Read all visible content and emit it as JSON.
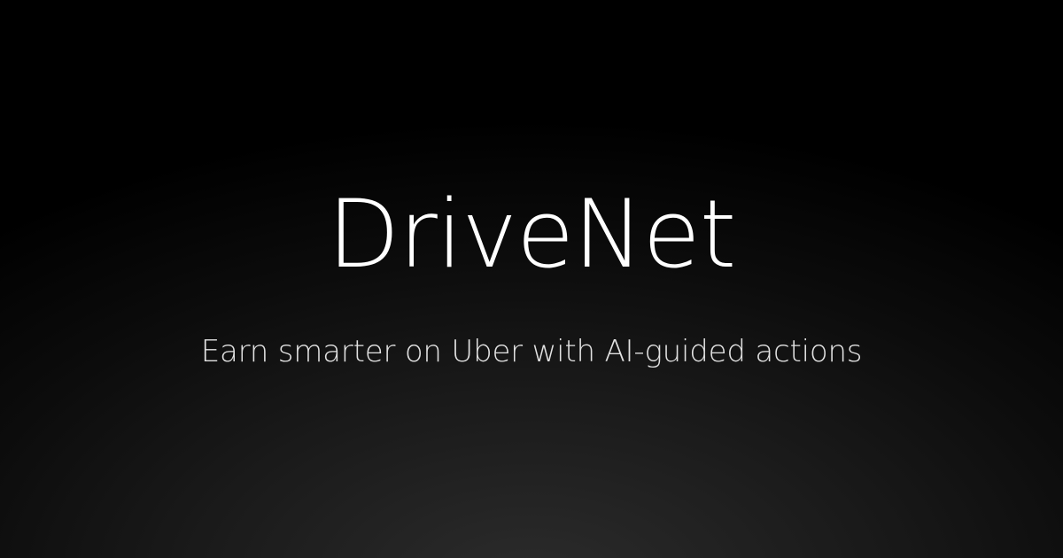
{
  "brand": {
    "name": "DriveNet",
    "tagline": "Earn smarter on Uber with AI-guided actions"
  },
  "colors": {
    "background": "#000000",
    "background_glow": "#2c2c2c",
    "title_text": "#ffffff",
    "tagline_text": "#e2e2e2"
  }
}
